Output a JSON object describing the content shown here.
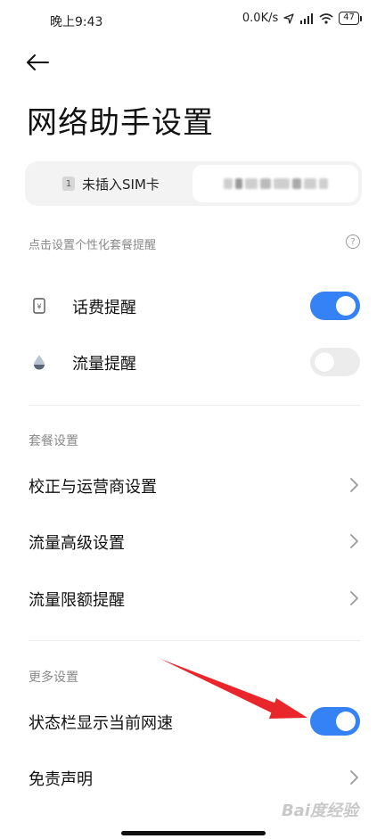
{
  "status_bar": {
    "time": "晚上9:43",
    "net_speed": "0.0K/s",
    "battery": "47"
  },
  "header": {
    "title": "网络助手设置"
  },
  "sim_tabs": {
    "sim1_number": "1",
    "sim1_label": "未插入SIM卡"
  },
  "reminders": {
    "hint": "点击设置个性化套餐提醒",
    "help": "?",
    "items": [
      {
        "label": "话费提醒",
        "icon": "phone-bill-icon",
        "enabled": true
      },
      {
        "label": "流量提醒",
        "icon": "data-drop-icon",
        "enabled": false
      }
    ]
  },
  "plan_settings": {
    "header": "套餐设置",
    "items": [
      {
        "label": "校正与运营商设置"
      },
      {
        "label": "流量高级设置"
      },
      {
        "label": "流量限额提醒"
      }
    ]
  },
  "more_settings": {
    "header": "更多设置",
    "speed_toggle": {
      "label": "状态栏显示当前网速",
      "enabled": true
    },
    "disclaimer": {
      "label": "免责声明"
    }
  },
  "watermark": "Bai度经验",
  "colors": {
    "accent": "#3482f6",
    "annotation_arrow": "#e8262b",
    "secondary_text": "#8a8a8a"
  }
}
